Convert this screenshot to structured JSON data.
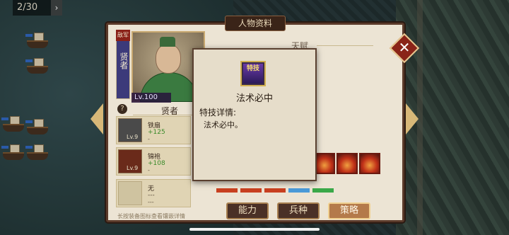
{
  "counter": {
    "text": "2/30",
    "arrow": "›"
  },
  "window": {
    "title": "人物资料",
    "close_symbol": "✕"
  },
  "hero": {
    "badge_top": "敌军",
    "badge_title": "贤者",
    "level": "Lv.100",
    "name": "贤者",
    "help_symbol": "?"
  },
  "equipment": [
    {
      "name": "铁扇",
      "stat": "+125",
      "extra": "-",
      "level": "Lv.9"
    },
    {
      "name": "锦袍",
      "stat": "+108",
      "extra": "-",
      "level": "Lv.9"
    },
    {
      "name": "无",
      "stat": "---",
      "extra": "---",
      "level": ""
    }
  ],
  "hint": "长按装备图标查看镶嵌详情",
  "talent_header": "天赋",
  "tabs": [
    {
      "label": "能力",
      "active": false
    },
    {
      "label": "兵种",
      "active": false
    },
    {
      "label": "策略",
      "active": true
    }
  ],
  "popup": {
    "icon_text": "特技",
    "title": "法术必中",
    "label": "特技详情:",
    "body": "法术必中。"
  },
  "colors": {
    "panel_bg": "#ece4d4",
    "frame": "#5a3a2a",
    "active_tab": "#b47a4a",
    "close_red": "#8a2418"
  }
}
